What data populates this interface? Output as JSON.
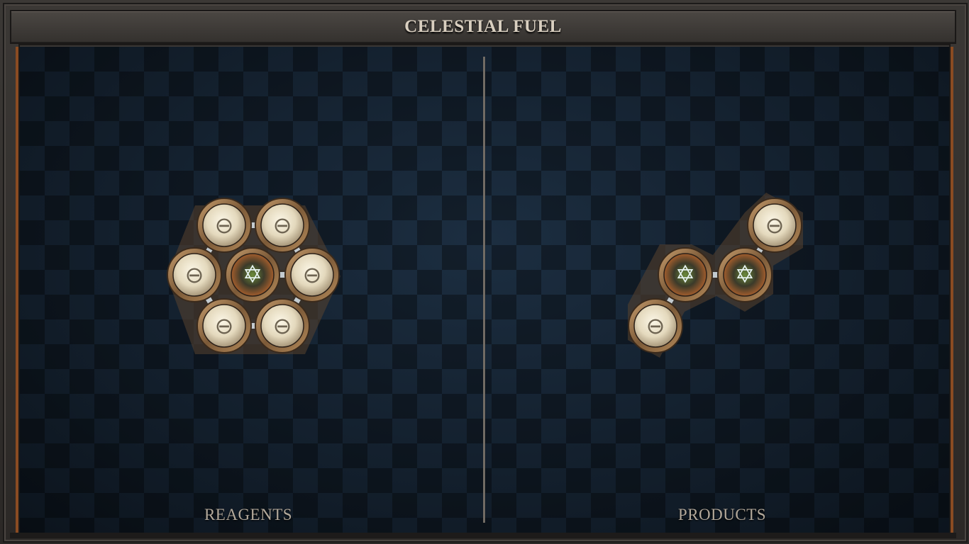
{
  "title": "CELESTIAL FUEL",
  "panels": {
    "reagents_label": "REAGENTS",
    "products_label": "PRODUCTS"
  },
  "elements": {
    "salt_symbol": "⊖",
    "aether_symbol": "✡"
  },
  "colors": {
    "salt_atom": "#e8dfc6",
    "atom_bronze": "#8d6a45",
    "bond_steel": "#b9c1c6",
    "board_bg": "#132232",
    "frame_border": "#8a4b22"
  },
  "reagent_molecule": {
    "atoms": [
      "salt",
      "salt",
      "salt",
      "aether",
      "salt",
      "salt",
      "salt"
    ]
  },
  "product_molecule": {
    "atoms": [
      "salt",
      "aether",
      "aether",
      "salt"
    ]
  }
}
